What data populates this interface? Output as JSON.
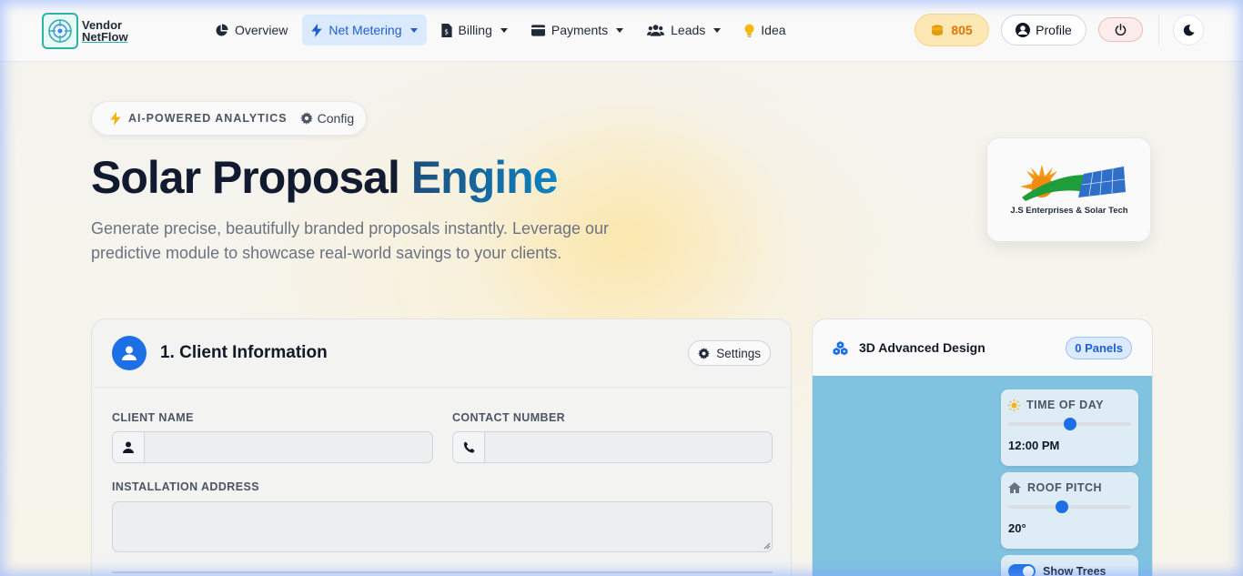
{
  "brand": {
    "line1": "Vendor",
    "line2": "NetFlow"
  },
  "nav": [
    {
      "label": "Overview",
      "icon": "pie-chart-icon",
      "dropdown": false,
      "active": false
    },
    {
      "label": "Net Metering",
      "icon": "bolt-icon",
      "dropdown": true,
      "active": true
    },
    {
      "label": "Billing",
      "icon": "invoice-icon",
      "dropdown": true,
      "active": false
    },
    {
      "label": "Payments",
      "icon": "wallet-icon",
      "dropdown": true,
      "active": false
    },
    {
      "label": "Leads",
      "icon": "users-icon",
      "dropdown": true,
      "active": false
    },
    {
      "label": "Idea",
      "icon": "lightbulb-icon",
      "dropdown": false,
      "active": false
    }
  ],
  "header": {
    "coins": "805",
    "profile_label": "Profile"
  },
  "hero": {
    "badge": "AI-POWERED ANALYTICS",
    "config_label": "Config",
    "title_main": "Solar Proposal",
    "title_accent": "Engine",
    "description": "Generate precise, beautifully branded proposals instantly. Leverage our predictive module to showcase real-world savings to your clients.",
    "company_name": "J.S Enterprises & Solar Tech"
  },
  "client_section": {
    "title": "1. Client Information",
    "settings_label": "Settings",
    "client_name_label": "CLIENT NAME",
    "client_name_value": "",
    "contact_label": "CONTACT NUMBER",
    "contact_value": "",
    "address_label": "INSTALLATION ADDRESS",
    "address_value": ""
  },
  "design_section": {
    "title": "3D Advanced Design",
    "panels_badge": "0 Panels",
    "time_of_day_label": "TIME OF DAY",
    "time_of_day_value": "12:00 PM",
    "time_of_day_level": 0.5,
    "roof_pitch_label": "ROOF PITCH",
    "roof_pitch_value": "20°",
    "roof_pitch_level": 0.44,
    "show_trees_label": "Show Trees",
    "show_trees_on": true
  },
  "colors": {
    "accent": "#1d6fe5",
    "coin": "#d97706",
    "brand_teal": "#2bb3a4",
    "scene_sky": "#80c3e1"
  }
}
